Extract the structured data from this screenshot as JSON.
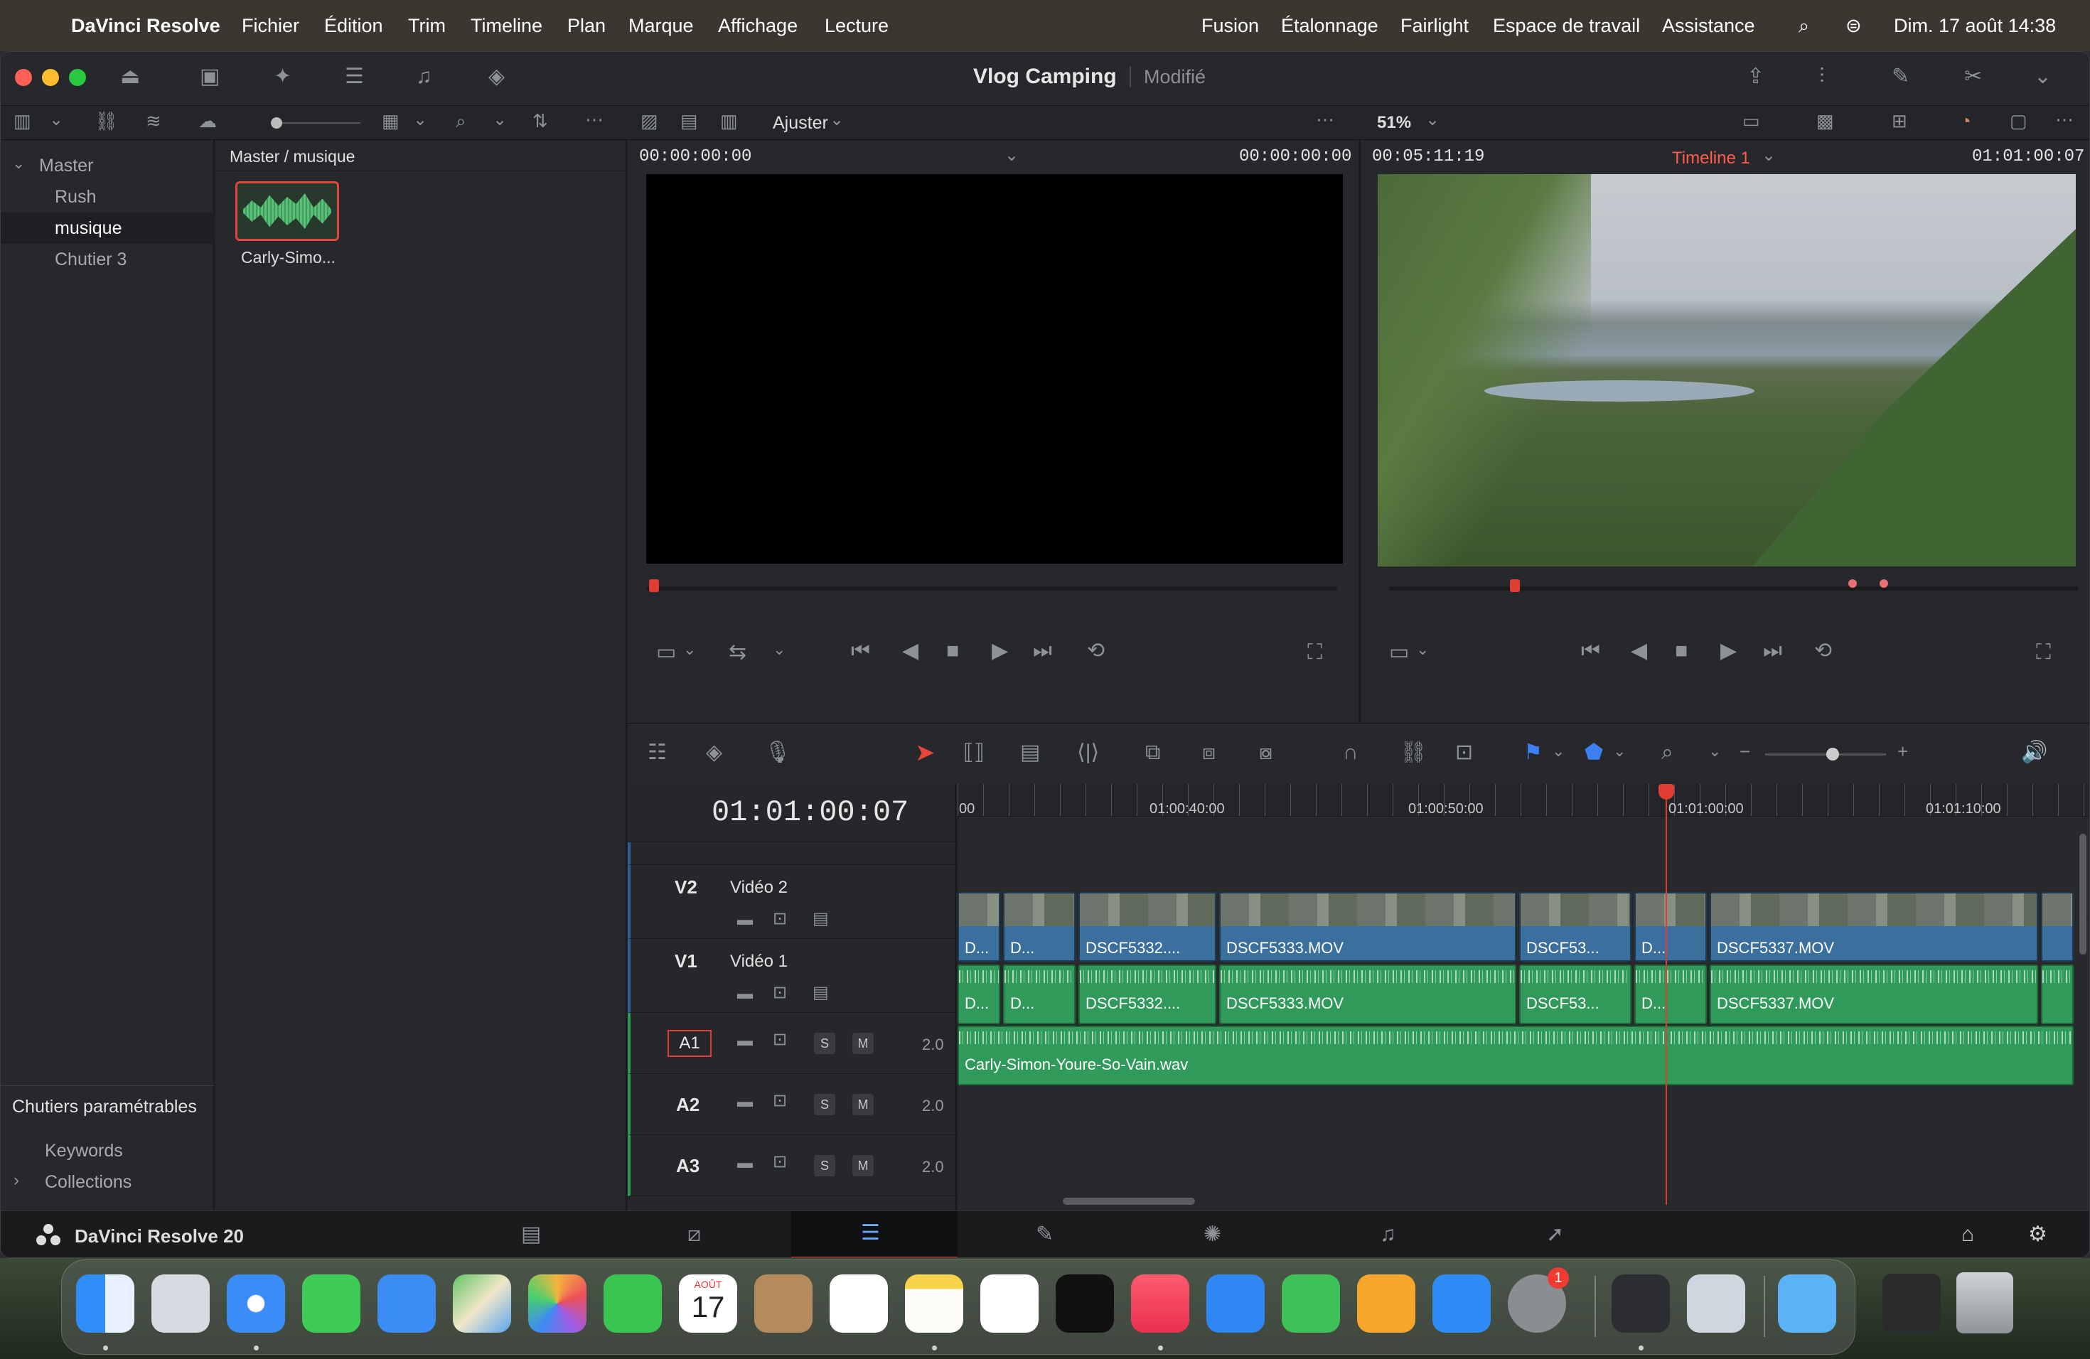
{
  "menubar": {
    "app": "DaVinci Resolve",
    "menus": [
      "Fichier",
      "Édition",
      "Trim",
      "Timeline",
      "Plan",
      "Marque",
      "Affichage",
      "Lecture"
    ],
    "right_menus": [
      "Fusion",
      "Étalonnage",
      "Fairlight",
      "Espace de travail",
      "Assistance"
    ],
    "clock": "Dim. 17 août  14:38"
  },
  "titlebar": {
    "project": "Vlog Camping",
    "state": "Modifié"
  },
  "subtoolbar": {
    "fit_label": "Ajuster",
    "zoom": "51%"
  },
  "mediapool": {
    "tree": [
      "Master",
      "Rush",
      "musique",
      "Chutier 3"
    ],
    "selected": "musique",
    "breadcrumb": "Master / musique",
    "clip": "Carly-Simo...",
    "smart_bins_title": "Chutiers paramétrables",
    "smart_bins": [
      "Keywords",
      "Collections"
    ]
  },
  "source_viewer": {
    "tc_left": "00:00:00:00",
    "tc_right": "00:00:00:00"
  },
  "program_viewer": {
    "duration": "00:05:11:19",
    "timeline_name": "Timeline 1",
    "tc": "01:01:00:07"
  },
  "timeline": {
    "current_tc": "01:01:00:07",
    "ruler": [
      "00",
      "01:00:40:00",
      "01:00:50:00",
      "01:01:00:00",
      "01:01:10:00"
    ],
    "tracks": [
      {
        "id": "V2",
        "name": "Vidéo 2"
      },
      {
        "id": "V1",
        "name": "Vidéo 1"
      },
      {
        "id": "A1",
        "ch": "2.0"
      },
      {
        "id": "A2",
        "ch": "2.0"
      },
      {
        "id": "A3",
        "ch": "2.0"
      }
    ],
    "solo": "S",
    "mute": "M",
    "video_clips": [
      "D...",
      "D...",
      "DSCF5332....",
      "DSCF5333.MOV",
      "DSCF53...",
      "D...",
      "DSCF5337.MOV"
    ],
    "audio_clips": [
      "D...",
      "D...",
      "DSCF5332....",
      "DSCF5333.MOV",
      "DSCF53...",
      "D...",
      "DSCF5337.MOV"
    ],
    "music_clip": "Carly-Simon-Youre-So-Vain.wav"
  },
  "bottom": {
    "app_version": "DaVinci Resolve 20"
  },
  "dock": {
    "calendar_month": "AOÛT",
    "calendar_day": "17",
    "badge": "1"
  }
}
